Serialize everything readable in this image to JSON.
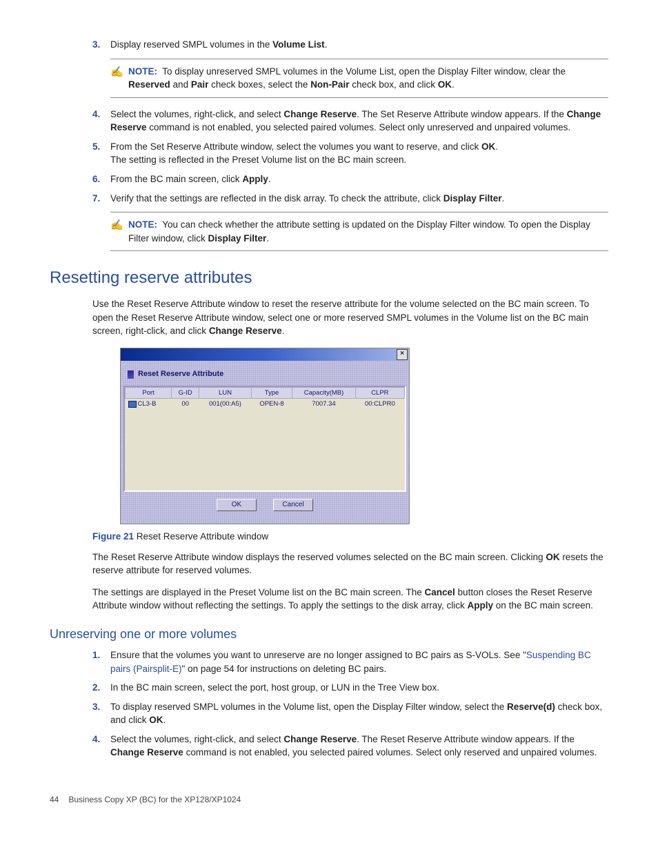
{
  "steps_top": [
    {
      "n": "3.",
      "html": "Display reserved SMPL volumes in the <b>Volume List</b>."
    },
    {
      "note": {
        "label": "NOTE:",
        "html": "To display unreserved SMPL volumes in the Volume List, open the Display Filter window, clear the <b>Reserved</b> and <b>Pair</b> check boxes, select the <b>Non-Pair</b> check box, and click <b>OK</b>."
      }
    },
    {
      "n": "4.",
      "html": "Select the volumes, right-click, and select <b>Change Reserve</b>. The Set Reserve Attribute window appears. If the <b>Change Reserve</b> command is not enabled, you selected paired volumes. Select only unreserved and unpaired volumes."
    },
    {
      "n": "5.",
      "html": "From the Set Reserve Attribute window, select the volumes you want to reserve, and click <b>OK</b>.<br>The setting is reflected in the Preset Volume list on the BC main screen."
    },
    {
      "n": "6.",
      "html": "From the BC main screen, click <b>Apply</b>."
    },
    {
      "n": "7.",
      "html": "Verify that the settings are reflected in the disk array. To check the attribute, click <b>Display Filter</b>."
    },
    {
      "note": {
        "label": "NOTE:",
        "html": "You can check whether the attribute setting is updated on the Display Filter window. To open the Display Filter window, click <b>Display Filter</b>."
      }
    }
  ],
  "section_reset_title": "Resetting reserve attributes",
  "reset_intro": "Use the Reset Reserve Attribute window to reset the reserve attribute for the volume selected on the BC main screen. To open the Reset Reserve Attribute window, select one or more reserved SMPL volumes in the Volume list on the BC main screen, right-click, and click <b>Change Reserve</b>.",
  "dialog": {
    "title": "Reset Reserve Attribute",
    "headers": [
      "Port",
      "G-ID",
      "LUN",
      "Type",
      "Capacity(MB)",
      "CLPR"
    ],
    "row": [
      "CL3-B",
      "00",
      "001(00:A5)",
      "OPEN-8",
      "7007.34",
      "00:CLPR0"
    ],
    "ok": "OK",
    "cancel": "Cancel",
    "close": "×"
  },
  "figure": {
    "label": "Figure 21",
    "text": " Reset Reserve Attribute window"
  },
  "reset_p1": "The Reset Reserve Attribute window displays the reserved volumes selected on the BC main screen. Clicking <b>OK</b> resets the reserve attribute for reserved volumes.",
  "reset_p2": "The settings are displayed in the Preset Volume list on the BC main screen. The <b>Cancel</b> button closes the Reset Reserve Attribute window without reflecting the settings. To apply the settings to the disk array, click <b>Apply</b> on the BC main screen.",
  "subsection_unreserve": "Unreserving one or more volumes",
  "steps_unreserve": [
    {
      "n": "1.",
      "html": "Ensure that the volumes you want to unreserve are no longer assigned to BC pairs as S-VOLs. See \"<span class='link'>Suspending BC pairs (Pairsplit-E)</span>\" on page 54 for instructions on deleting BC pairs."
    },
    {
      "n": "2.",
      "html": "In the BC main screen, select the port, host group, or LUN in the Tree View box."
    },
    {
      "n": "3.",
      "html": "To display reserved SMPL volumes in the Volume list, open the Display Filter window, select the <b>Reserve(d)</b> check box, and click <b>OK</b>."
    },
    {
      "n": "4.",
      "html": "Select the volumes, right-click, and select <b>Change Reserve</b>. The Reset Reserve Attribute window appears. If the <b>Change Reserve</b> command is not enabled, you selected paired volumes. Select only reserved and unpaired volumes."
    }
  ],
  "footer": {
    "page": "44",
    "doc": "Business Copy XP (BC) for the XP128/XP1024"
  }
}
